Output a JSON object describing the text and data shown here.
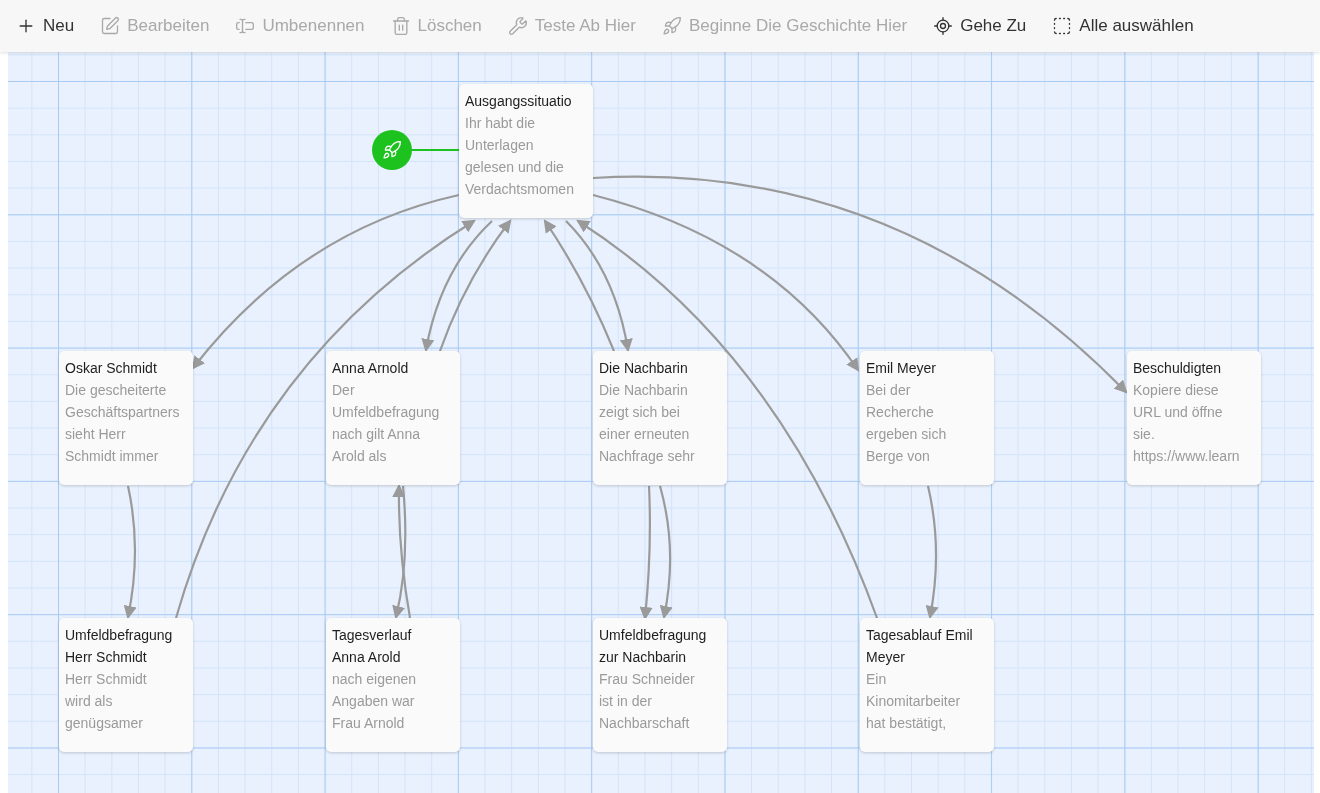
{
  "toolbar": [
    {
      "kind": "new",
      "label": "Neu",
      "disabled": false
    },
    {
      "kind": "edit",
      "label": "Bearbeiten",
      "disabled": true
    },
    {
      "kind": "rename",
      "label": "Umbenennen",
      "disabled": true
    },
    {
      "kind": "delete",
      "label": "Löschen",
      "disabled": true
    },
    {
      "kind": "test",
      "label": "Teste Ab Hier",
      "disabled": true
    },
    {
      "kind": "start",
      "label": "Beginne Die Geschichte Hier",
      "disabled": true
    },
    {
      "kind": "goto",
      "label": "Gehe Zu",
      "disabled": false
    },
    {
      "kind": "selectall",
      "label": "Alle auswählen",
      "disabled": false
    }
  ],
  "passages": [
    {
      "title": "Ausgangssituatio",
      "excerpt": "Ihr habt die\nUnterlagen\ngelesen und die\nVerdachtsmomen",
      "start": true
    },
    {
      "title": "Oskar Schmidt",
      "excerpt": "Die gescheiterte\nGeschäftspartners\nsieht Herr\nSchmidt immer",
      "start": false
    },
    {
      "title": "Anna Arnold",
      "excerpt": "Der\nUmfeldbefragung\nnach gilt Anna\nArold als",
      "start": false
    },
    {
      "title": "Die Nachbarin",
      "excerpt": "Die Nachbarin\nzeigt sich bei\neiner erneuten\nNachfrage sehr",
      "start": false
    },
    {
      "title": "Emil Meyer",
      "excerpt": "Bei der\nRecherche\nergeben sich\nBerge von",
      "start": false
    },
    {
      "title": "Beschuldigten",
      "excerpt": "Kopiere diese\nURL und öffne\nsie.\nhttps://www.learn",
      "start": false
    },
    {
      "title": "Umfeldbefragung\nHerr Schmidt",
      "excerpt": "Herr Schmidt\nwird als\ngenügsamer",
      "start": false
    },
    {
      "title": "Tagesverlauf\nAnna Arold",
      "excerpt": "nach eigenen\nAngaben war\nFrau Arnold",
      "start": false
    },
    {
      "title": "Umfeldbefragung\nzur Nachbarin",
      "excerpt": "Frau Schneider\nist in der\nNachbarschaft",
      "start": false
    },
    {
      "title": "Tagesablauf Emil\nMeyer",
      "excerpt": "Ein\nKinomitarbeiter\nhat bestätigt,",
      "start": false
    }
  ]
}
